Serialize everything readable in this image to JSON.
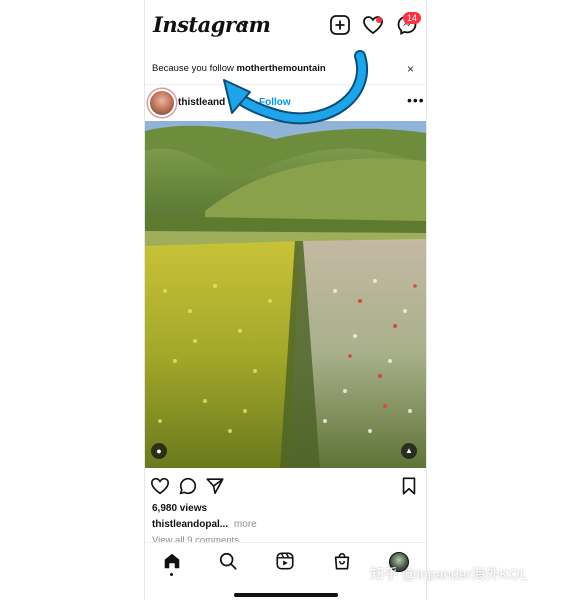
{
  "header": {
    "logo": "Instagram",
    "notification_count": "14"
  },
  "suggestion": {
    "prefix": "Because you follow ",
    "account": "motherthemountain",
    "close_label": "×"
  },
  "post": {
    "username": "thistleand",
    "follow_label": "Follow",
    "more_label": "•••",
    "views": "6,980 views",
    "caption_user": "thistleandopal...",
    "caption_more": "more",
    "comments_link": "View all 9 comments"
  },
  "icons": {
    "header": [
      "instagram-logo",
      "chevron-down-icon",
      "new-post-icon",
      "heart-icon",
      "messenger-icon"
    ],
    "actions": [
      "like-icon",
      "comment-icon",
      "share-icon",
      "bookmark-icon"
    ],
    "nav": [
      "home-icon",
      "search-icon",
      "reels-icon",
      "shop-icon",
      "profile-avatar"
    ]
  },
  "colors": {
    "accent_blue": "#0095f6",
    "badge_red": "#ff3040",
    "annotation_arrow": "#1ea5e9"
  },
  "watermark": "知乎 @Inpander海外KOL"
}
